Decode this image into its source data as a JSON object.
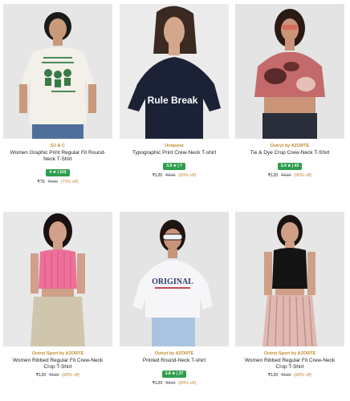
{
  "colors": {
    "brand_text": "#c08a2d",
    "rating_bg": "#2e9e4b",
    "discount": "#c58b3a"
  },
  "products": [
    {
      "brand": "DJ & C",
      "title": "Women Graphic Print Regular Fit Round-Neck T-Shirt",
      "rating": "4 ★ | 103",
      "price": "₹75",
      "mrp": "₹699",
      "discount": "(75% off)",
      "tee_print": ""
    },
    {
      "brand": "Uniquest",
      "title": "Typographic Print Crew-Neck T-shirt",
      "rating": "3.9 ★ | 7",
      "price": "₹120",
      "mrp": "₹599",
      "discount": "(80% off)",
      "tee_print": "Rule Break"
    },
    {
      "brand": "Outryt by AZORTE",
      "title": "Tie & Dye Crop Crew-Neck T-Shirt",
      "rating": "3.4 ★ | 43",
      "price": "₹120",
      "mrp": "₹599",
      "discount": "(80% off)",
      "tee_print": ""
    },
    {
      "brand": "Outryt Sport by AZORTE",
      "title": "Women Ribbed Regular Fit Crew-Neck Crop T-Shirt",
      "rating": "",
      "price": "₹120",
      "mrp": "₹599",
      "discount": "(80% off)",
      "tee_print": ""
    },
    {
      "brand": "Outryt by AZORTE",
      "title": "Printed Round-Neck T-shirt",
      "rating": "3.8 ★ | 27",
      "price": "₹120",
      "mrp": "₹599",
      "discount": "(80% off)",
      "tee_print": "ORIGINAL"
    },
    {
      "brand": "Outryt Sport by AZORTE",
      "title": "Women Ribbed Regular Fit Crew-Neck Crop T-Shirt",
      "rating": "",
      "price": "₹120",
      "mrp": "₹599",
      "discount": "(80% off)",
      "tee_print": ""
    }
  ]
}
